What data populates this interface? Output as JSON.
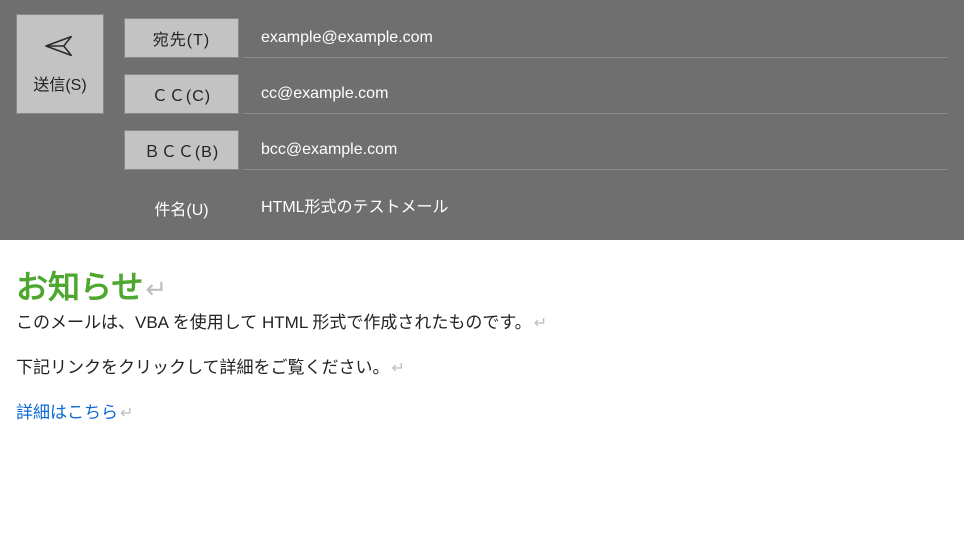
{
  "send": {
    "label": "送信(S)",
    "icon_name": "send-icon"
  },
  "fields": {
    "to": {
      "label": "宛先(T)",
      "value": "example@example.com"
    },
    "cc": {
      "label": "ＣＣ(C)",
      "value": "cc@example.com"
    },
    "bcc": {
      "label": "ＢＣＣ(B)",
      "value": "bcc@example.com"
    },
    "subject": {
      "label": "件名(U)",
      "value": "HTML形式のテストメール"
    }
  },
  "body": {
    "heading": "お知らせ",
    "para1": "このメールは、VBA を使用して HTML 形式で作成されたものです。",
    "para2": "下記リンクをクリックして詳細をご覧ください。",
    "link_text": "詳細はこちら"
  },
  "marks": {
    "pilcrow": "↵"
  }
}
